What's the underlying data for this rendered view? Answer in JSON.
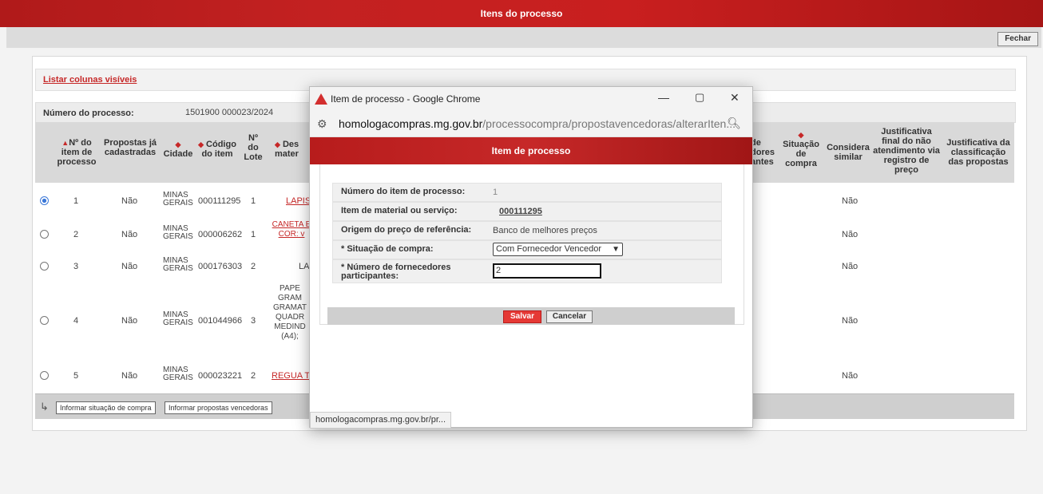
{
  "page": {
    "title": "Itens do processo",
    "close_label": "Fechar"
  },
  "listar_link": "Listar colunas visíveis",
  "process": {
    "label": "Número do processo:",
    "value": "1501900 000023/2024"
  },
  "columns": {
    "item": "Nº do item de processo",
    "propostas": "Propostas já cadastradas",
    "cidade": "Cidade",
    "codigo": "Código do item",
    "lote": "Nº do Lote",
    "desc": "Des mater",
    "fornecedores": "de dores antes",
    "situacao": "Situação de compra",
    "considera": "Considera similar",
    "justificativa_final": "Justificativa final do não atendimento via registro de preço",
    "justificativa_class": "Justificativa da classificação das propostas"
  },
  "rows": [
    {
      "item": "1",
      "propostas": "Não",
      "cidade1": "MINAS",
      "cidade2": "GERAIS",
      "codigo": "000111295",
      "lote": "1",
      "desc": "LAPIS",
      "similar": "Não",
      "selected": true
    },
    {
      "item": "2",
      "propostas": "Não",
      "cidade1": "MINAS",
      "cidade2": "GERAIS",
      "codigo": "000006262",
      "lote": "1",
      "desc": "CANETA E COR: v",
      "similar": "Não",
      "selected": false
    },
    {
      "item": "3",
      "propostas": "Não",
      "cidade1": "MINAS",
      "cidade2": "GERAIS",
      "codigo": "000176303",
      "lote": "2",
      "desc": "LA",
      "similar": "Não",
      "selected": false
    },
    {
      "item": "4",
      "propostas": "Não",
      "cidade1": "MINAS",
      "cidade2": "GERAIS",
      "codigo": "001044966",
      "lote": "3",
      "desc": "PAPE GRAM GRAMAT QUADR MEDIND (A4);",
      "similar": "Não",
      "selected": false
    },
    {
      "item": "5",
      "propostas": "Não",
      "cidade1": "MINAS",
      "cidade2": "GERAIS",
      "codigo": "000023221",
      "lote": "2",
      "desc": "REGUA T",
      "similar": "Não",
      "selected": false
    }
  ],
  "footer": {
    "btn1": "Informar situação de compra",
    "btn2": "Informar propostas vencedoras"
  },
  "popup": {
    "window_title": "Item de processo - Google Chrome",
    "url_host": "homologacompras.mg.gov.br",
    "url_path": "/processocompra/propostavencedoras/alterarIten...",
    "header": "Item de processo",
    "fields": {
      "numero_label": "Número do item de processo:",
      "numero_value": "1",
      "material_label": "Item de material ou serviço:",
      "material_value": "000111295",
      "origem_label": "Origem do preço de referência:",
      "origem_value": "Banco de melhores preços",
      "situacao_label": "* Situação de compra:",
      "situacao_value": "Com Fornecedor Vencedor",
      "fornecedores_label1": "* Número de fornecedores",
      "fornecedores_label2": "participantes:",
      "fornecedores_value": "2"
    },
    "save_label": "Salvar",
    "cancel_label": "Cancelar",
    "status_url": "homologacompras.mg.gov.br/pr..."
  },
  "colors": {
    "brand_red": "#c62828",
    "accent_blue": "#3b78d8"
  }
}
